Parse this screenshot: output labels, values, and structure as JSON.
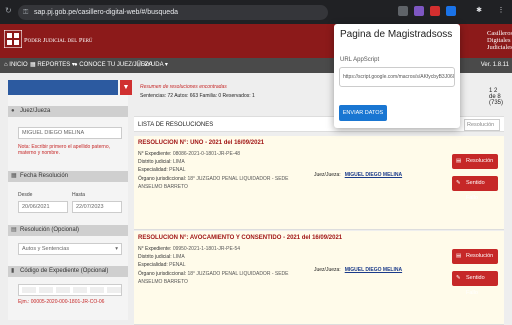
{
  "browser": {
    "url": "sap.pj.gob.pe/casillero-digital-web/#/busqueda",
    "extensions": [
      "",
      "",
      "",
      "",
      "",
      ""
    ]
  },
  "site": {
    "pj_title": "Poder Judicial del Perú",
    "cd_title": "Casilleros Digitales Judiciales"
  },
  "menu": {
    "inicio": "INICIO",
    "reportes": "REPORTES",
    "juez": "CONOCE TU JUEZ/JUEZA",
    "ayuda": "AYUDA",
    "version": "Ver. 1.8.11"
  },
  "sidebar": {
    "juez_head": "Juez/Jueza",
    "juez_value": "MIGUEL DIEGO MELINA",
    "juez_note": "Nota: Escribir primero el apellido paterno, materno y nombre.",
    "fecha_head": "Fecha Resolución",
    "desde_label": "Desde",
    "hasta_label": "Hasta",
    "desde_value": "20/06/2021",
    "hasta_value": "22/07/2023",
    "resolucion_head": "Resolución (Opcional)",
    "resolucion_value": "Autos y Sentencias",
    "codigo_head": "Código de Expediente (Opcional)",
    "codigo_example": "Ejm.: 00005-2020-000-1801-JR-CO-06"
  },
  "main": {
    "resumen": "Resumen de resoluciones encontradas",
    "sentencias": "Sentencias: 72 Autos: 663 Familia: 0 Reservados: 1",
    "pager": "1 2 de 8 (735)",
    "list_header": "LISTA DE RESOLUCIONES",
    "filter_placeholder": "Resolución"
  },
  "cards": [
    {
      "title": "RESOLUCION N°: UNO - 2021 del 16/09/2021",
      "expediente_label": "N° Expediente:",
      "expediente": "08086-2021-0-1801-JR-PE-48",
      "distrito_label": "Distrito judicial:",
      "distrito": "LIMA",
      "especialidad_label": "Especialidad:",
      "especialidad": "PENAL",
      "organo_label": "Órgano jurisdiccional:",
      "organo": "18° JUZGADO PENAL LIQUIDADOR - SEDE ANSELMO BARRETO",
      "juez_label": "Juez/Jueza:",
      "juez": "MIGUEL DIEGO MELINA",
      "btn1": "Resolución",
      "btn2": "Sentido Fallo"
    },
    {
      "title": "RESOLUCION N°: AVOCAMIENTO Y CONSENTIDO - 2021 del 16/09/2021",
      "expediente_label": "N° Expediente:",
      "expediente": "09950-2021-1-1801-JR-PE-54",
      "distrito_label": "Distrito judicial:",
      "distrito": "LIMA",
      "especialidad_label": "Especialidad:",
      "especialidad": "PENAL",
      "organo_label": "Órgano jurisdiccional:",
      "organo": "18° JUZGADO PENAL LIQUIDADOR - SEDE ANSELMO BARRETO",
      "juez_label": "Juez/Jueza:",
      "juez": "MIGUEL DIEGO MELINA",
      "btn1": "Resolución",
      "btn2": "Sentido Fallo"
    }
  ],
  "popup": {
    "title": "Pagina de Magistradsoss",
    "label": "URL AppScript",
    "input_value": "https://script.google.com/macros/s/AKfycbyB3J06004cpK",
    "button": "ENVIAR DATOS"
  },
  "colors": {
    "banner": "#8c1a1a",
    "accent_red": "#c62828",
    "popup_button": "#1976d2"
  }
}
